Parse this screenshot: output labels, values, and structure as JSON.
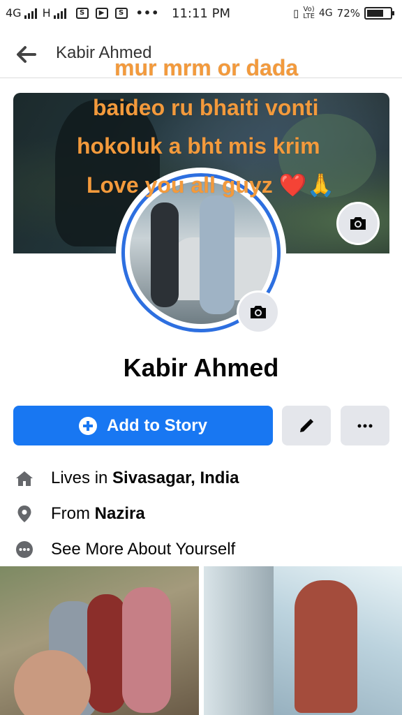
{
  "status_bar": {
    "left": "4G",
    "h": "H",
    "time": "11:11 PM",
    "network": "4G",
    "lte": "LTE",
    "battery": "72%",
    "battery_level": 0.72
  },
  "header": {
    "title": "Kabir Ahmed"
  },
  "cover_caption": {
    "line1": "mur mrm or dada",
    "line2": "baideo ru bhaiti vonti",
    "line3": "hokoluk a bht mis krim",
    "line4": "Love you all guyz ❤️🙏"
  },
  "profile": {
    "name": "Kabir Ahmed"
  },
  "actions": {
    "add_story": "Add to Story"
  },
  "info": {
    "lives_prefix": "Lives in ",
    "lives_place": "Sivasagar, India",
    "from_prefix": "From ",
    "from_place": "Nazira",
    "see_more": "See More About Yourself"
  },
  "icons": {
    "back": "back-arrow-icon",
    "camera": "camera-icon",
    "pencil": "pencil-icon",
    "more": "more-dots-icon",
    "home": "home-icon",
    "location": "location-pin-icon",
    "dots": "dots-circle-icon"
  },
  "colors": {
    "accent": "#1877f2",
    "caption": "#f39a3c",
    "button_gray": "#e4e6eb"
  }
}
